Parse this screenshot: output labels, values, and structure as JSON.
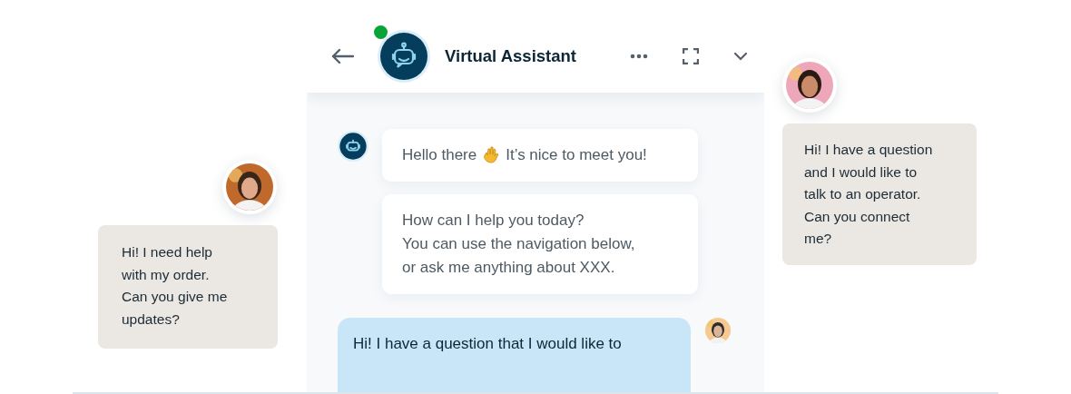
{
  "side_chats": [
    {
      "kind": "left",
      "text": "Hi! I need help\nwith my order.\nCan you give me\nupdates?"
    },
    {
      "kind": "right",
      "text": "Hi! I have a question\nand I would like to\ntalk to an operator.\nCan you connect\nme?"
    }
  ],
  "chat_window": {
    "title": "Virtual Assistant",
    "online": true,
    "messages": [
      {
        "kind": "bot",
        "show_avatar": true,
        "parts": [
          "Hello there",
          "It’s nice to meet you!"
        ]
      },
      {
        "kind": "bot",
        "show_avatar": false,
        "parts": [
          "How can I help you today?\nYou can use the navigation below,\nor ask me anything about XXX."
        ]
      },
      {
        "kind": "user",
        "show_avatar": true,
        "parts": [
          "Hi! I have a question that I would like to"
        ]
      }
    ]
  }
}
